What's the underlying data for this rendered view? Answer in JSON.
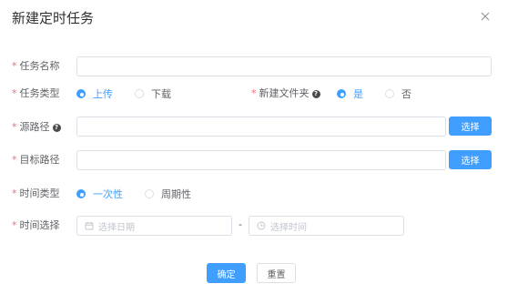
{
  "dialog": {
    "title": "新建定时任务",
    "close_icon": "close-icon"
  },
  "form": {
    "required_mark": "*",
    "task_name": {
      "label": "任务名称",
      "value": ""
    },
    "task_type": {
      "label": "任务类型",
      "options": [
        "上传",
        "下载"
      ],
      "selected": "上传"
    },
    "new_folder": {
      "label": "新建文件夹",
      "help_icon": "question-circle-icon",
      "options": [
        "是",
        "否"
      ],
      "selected": "是"
    },
    "source_path": {
      "label": "源路径",
      "help_icon": "question-circle-icon",
      "value": "",
      "button_label": "选择"
    },
    "target_path": {
      "label": "目标路径",
      "value": "",
      "button_label": "选择"
    },
    "time_type": {
      "label": "时间类型",
      "options": [
        "一次性",
        "周期性"
      ],
      "selected": "一次性"
    },
    "time_select": {
      "label": "时间选择",
      "date_placeholder": "选择日期",
      "date_icon": "calendar-icon",
      "separator": "-",
      "time_placeholder": "选择时间",
      "time_icon": "clock-icon"
    }
  },
  "footer": {
    "confirm_label": "确定",
    "reset_label": "重置"
  },
  "colors": {
    "primary": "#409eff",
    "required": "#f56c6c",
    "border": "#dcdfe6",
    "placeholder": "#c0c4cc"
  }
}
